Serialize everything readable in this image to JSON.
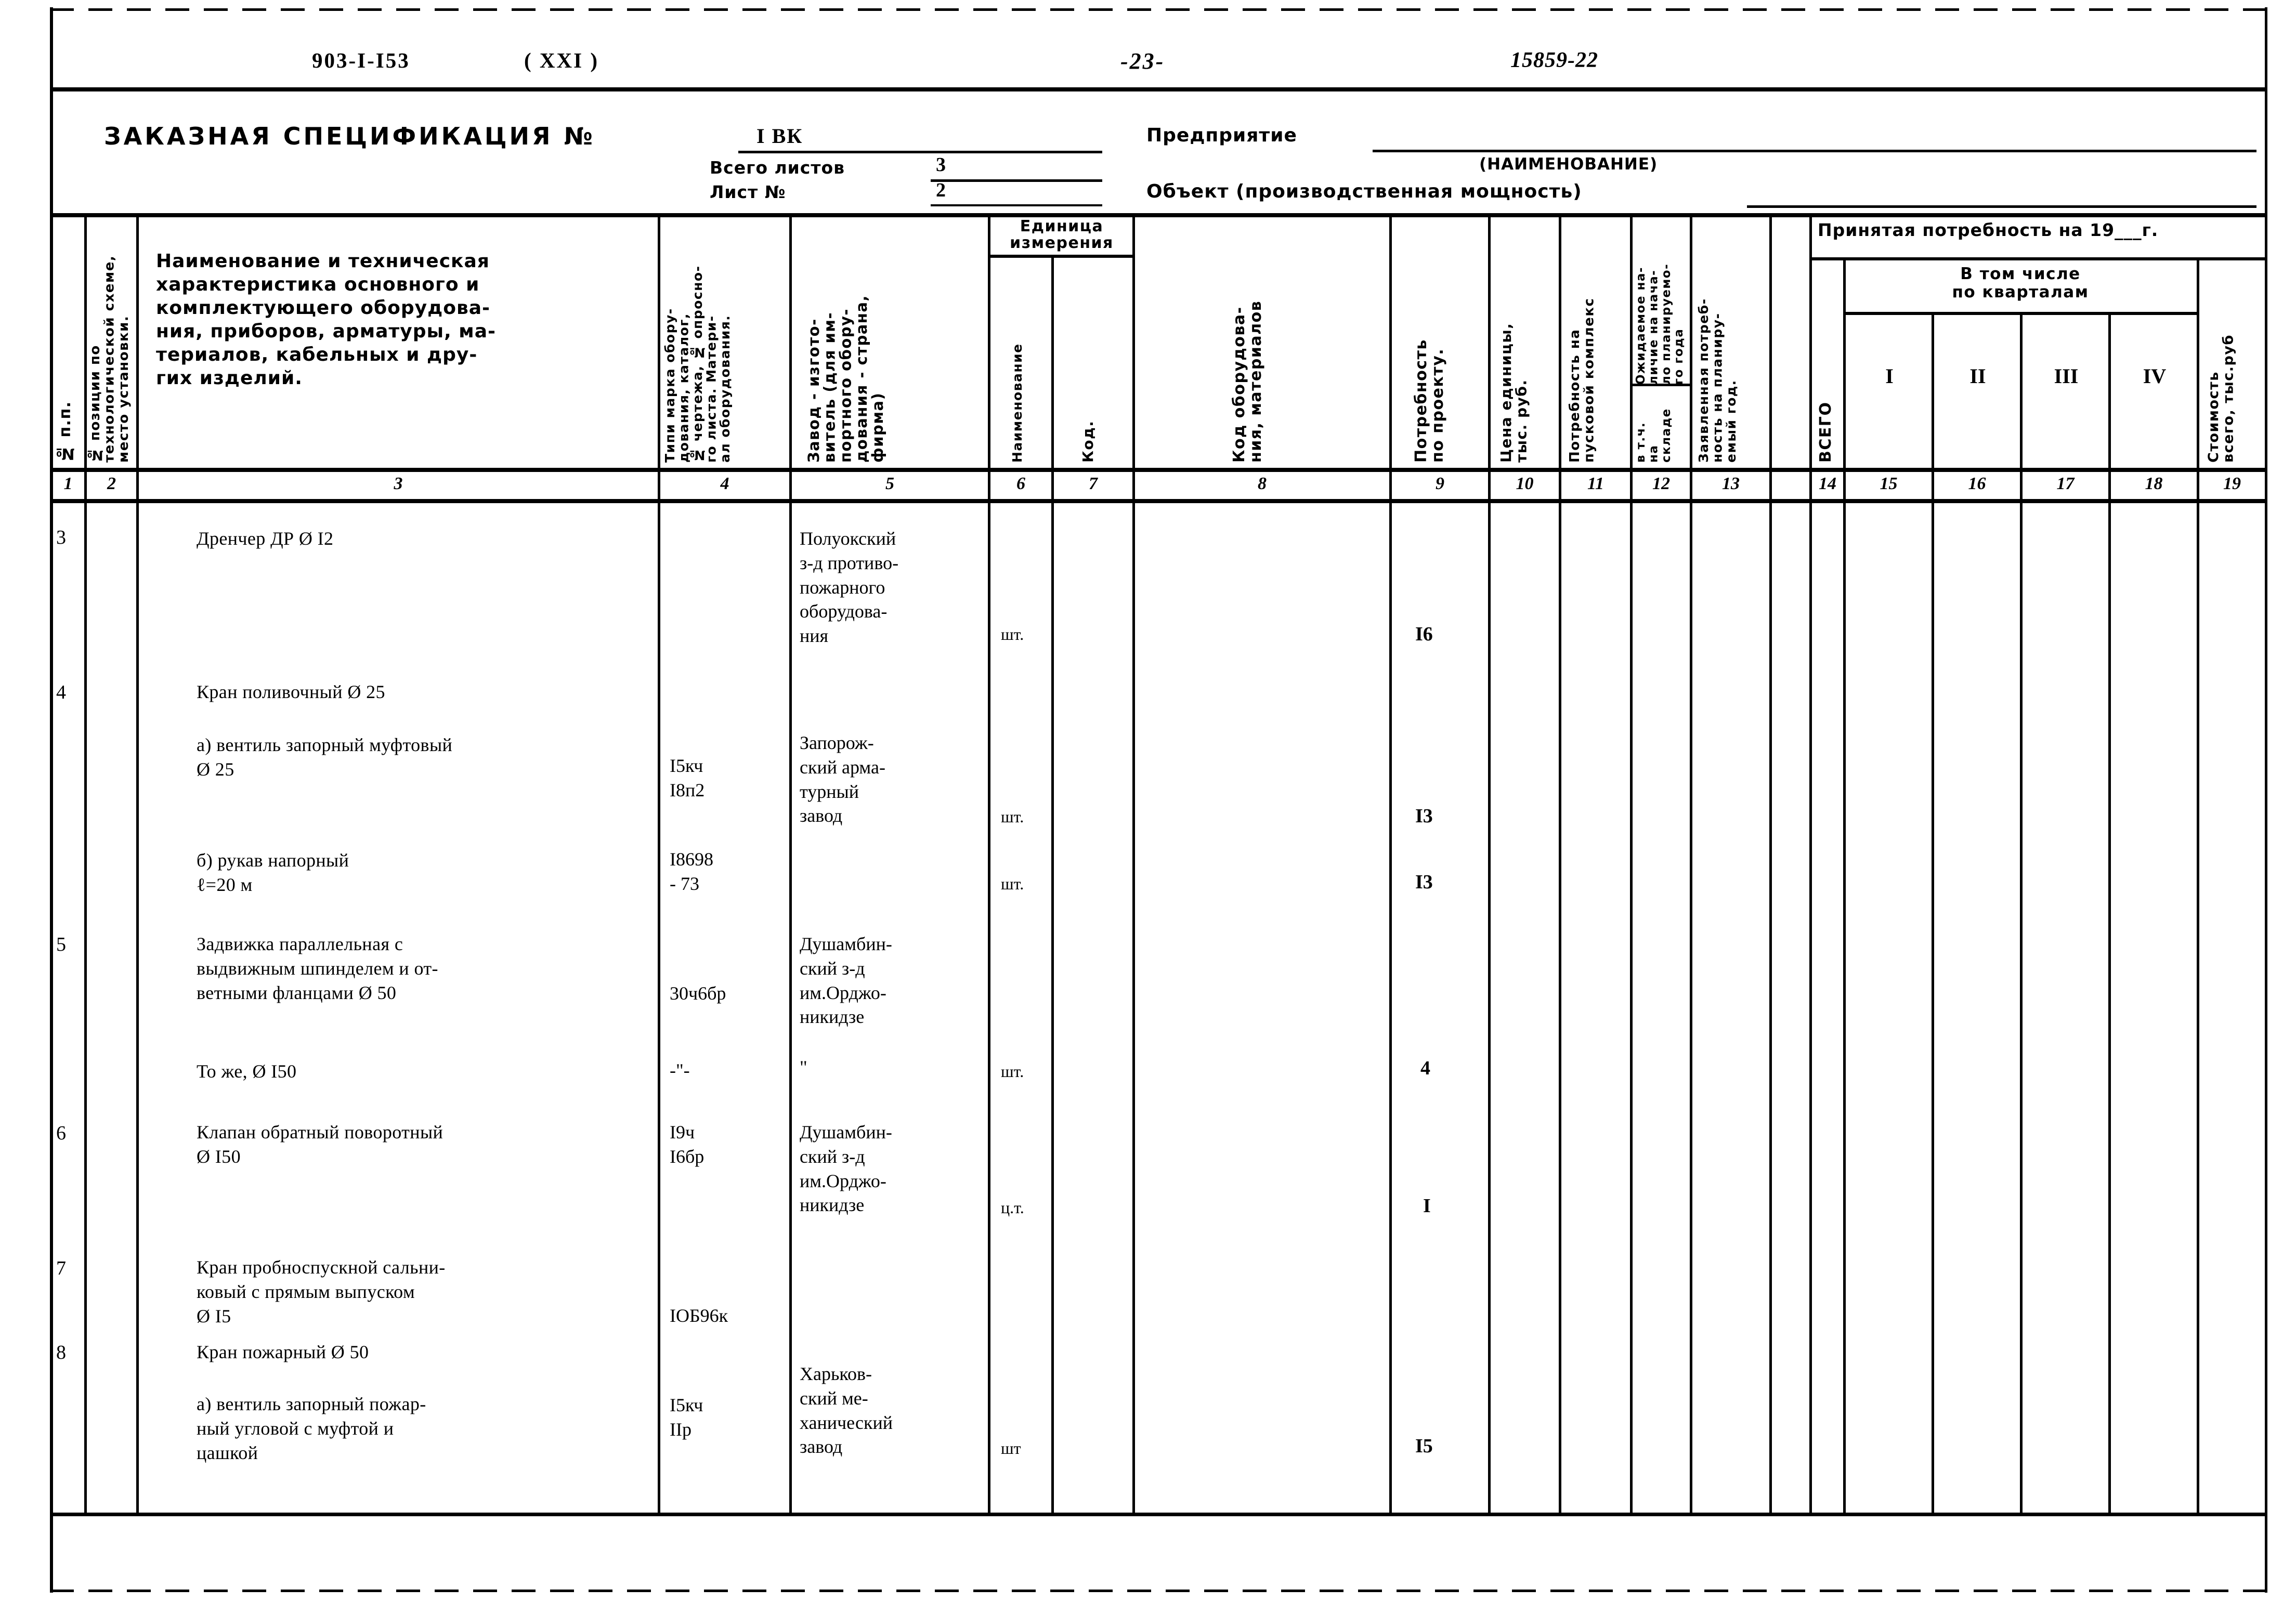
{
  "header": {
    "doc_code": "903-I-I53",
    "doc_series": "( XXI )",
    "page_number": "-23-",
    "hand_number": "15859-22"
  },
  "title_block": {
    "spec_title": "ЗАКАЗНАЯ СПЕЦИФИКАЦИЯ №",
    "spec_number": "I ВК",
    "total_sheets_label": "Всего листов",
    "total_sheets_value": "3",
    "sheet_no_label": "Лист №",
    "sheet_no_value": "2",
    "enterprise_label": "Предприятие",
    "naименование_label": "(НАИМЕНОВАНИЕ)",
    "object_label": "Объект (производственная мощность)"
  },
  "columns": {
    "c1": "№ п.п.",
    "c2": "№ позиции по технологической схеме,\nместо установки.",
    "c3": "Наименование и техническая\nхарактеристика основного и\nкомплектующего оборудова-\nния, приборов, арматуры, ма-\nтериалов, кабельных и дру-\nгих изделий.",
    "c4": "Типи марка обору-\nдования, каталог,\n№ чертежа, № опросно-\nго листа. Матери-\nал оборудования.",
    "c5": "Завод - изгото-\nвитель (для им-\nпортного обору-\nдования - страна,\nфирма)",
    "c6_group": "Единица\nизмерения",
    "c6": "Наименование",
    "c7": "Код.",
    "c8": "Код оборудова-\nния, материалов",
    "c9": "Потребность\nпо проекту.",
    "c10": "Цена единицы,\nтыс. руб.",
    "c11": "Потребность на\nпусковой комплекс",
    "c12a": "Ожидаемое на-\nличие на нача-\nло планируемо-\nго года",
    "c12b": "в т.ч.\nна\nскладе",
    "c13": "Заявленная потреб-\nность на планиру-\nемый год.",
    "c14_group": "Принятая  потребность на 19___г.",
    "c14": "ВСЕГО",
    "c15_18_group": "В том  числе\nпо  кварталам",
    "c15": "I",
    "c16": "II",
    "c17": "III",
    "c18": "IV",
    "c19": "Стоимость\nвсего, тыс.руб"
  },
  "column_numbers": [
    "1",
    "2",
    "3",
    "4",
    "5",
    "6",
    "7",
    "8",
    "9",
    "10",
    "11",
    "12",
    "13",
    "14",
    "15",
    "16",
    "17",
    "18",
    "19"
  ],
  "rows": [
    {
      "num": "3",
      "name": "Дренчер  ДР Ø I2",
      "mark": "",
      "maker": "Полуокский\nз-д противо-\nпожарного\nоборудова-\nния",
      "unit": "шт.",
      "qty": "I6"
    },
    {
      "num": "4",
      "name": "Кран поливочный Ø 25",
      "mark": "",
      "maker": "",
      "unit": "",
      "qty": ""
    },
    {
      "num": "",
      "name": "а) вентиль запорный муфтовый\n              Ø 25",
      "mark": "I5кч\nI8п2",
      "maker": "Запорож-\nский арма-\nтурный\nзавод",
      "unit": "шт.",
      "qty": "I3"
    },
    {
      "num": "",
      "name": "б) рукав напорный\n           ℓ=20 м",
      "mark": "I8698\n- 73",
      "maker": "",
      "unit": "шт.",
      "qty": "I3"
    },
    {
      "num": "5",
      "name": "Задвижка параллельная с\nвыдвижным шпинделем и от-\nветными фланцами Ø 50",
      "mark": "30ч6бр",
      "maker": "Душамбин-\nский з-д\nим.Орджо-\nникидзе",
      "unit": "",
      "qty": ""
    },
    {
      "num": "",
      "name": "То же, Ø I50",
      "mark": "-\"-",
      "maker": "\"",
      "unit": "шт.",
      "qty": "4"
    },
    {
      "num": "6",
      "name": "Клапан обратный поворотный\n          Ø I50",
      "mark": "I9ч\nI6бр",
      "maker": "Душамбин-\nский з-д\nим.Орджо-\nникидзе",
      "unit": "ц.т.",
      "qty": "I"
    },
    {
      "num": "7",
      "name": "Кран пробноспускной сальни-\nковый с прямым выпуском\n          Ø I5",
      "mark": "IОБ96к",
      "maker": "",
      "unit": "",
      "qty": ""
    },
    {
      "num": "8",
      "name": "Кран пожарный Ø 50",
      "mark": "",
      "maker": "",
      "unit": "",
      "qty": ""
    },
    {
      "num": "",
      "name": "а) вентиль запорный пожар-\n    ный угловой с муфтой и\n    цашкой",
      "mark": "I5кч\nIIp",
      "maker": "Харьков-\nский ме-\nханический\nзавод",
      "unit": "шт",
      "qty": "I5"
    }
  ]
}
